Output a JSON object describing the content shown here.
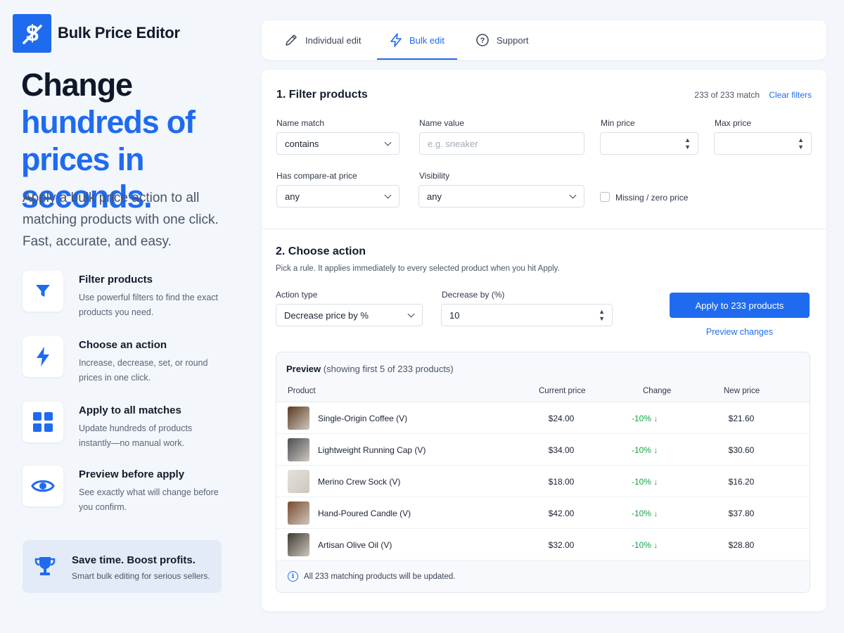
{
  "brand": {
    "name": "Bulk Price Editor"
  },
  "hero": {
    "line1": "Change",
    "line2": "hundreds of",
    "line3": "prices in seconds.",
    "subtitle": "Apply a bulk price action to all matching products with one click. Fast, accurate, and easy."
  },
  "features": [
    {
      "icon": "filter-icon",
      "title": "Filter products",
      "desc": "Use powerful filters to find the exact products you need."
    },
    {
      "icon": "lightning-icon",
      "title": "Choose an action",
      "desc": "Increase, decrease, set, or round prices in one click."
    },
    {
      "icon": "grid-icon",
      "title": "Apply to all matches",
      "desc": "Update hundreds of products instantly—no manual work."
    },
    {
      "icon": "eye-icon",
      "title": "Preview before apply",
      "desc": "See exactly what will change before you confirm."
    }
  ],
  "promo": {
    "icon": "trophy-icon",
    "title": "Save time. Boost profits.",
    "desc": "Smart bulk editing for serious sellers."
  },
  "tabs": [
    {
      "icon": "pencil-icon",
      "label": "Individual edit",
      "active": false
    },
    {
      "icon": "lightning-icon",
      "label": "Bulk edit",
      "active": true
    },
    {
      "icon": "question-icon",
      "label": "Support",
      "active": false
    }
  ],
  "filter": {
    "title": "1. Filter products",
    "match_count": "233 of 233 match",
    "clear_label": "Clear filters",
    "name_match": {
      "label": "Name match",
      "value": "contains"
    },
    "name_value": {
      "label": "Name value",
      "placeholder": "e.g. sneaker",
      "value": ""
    },
    "min_price": {
      "label": "Min price",
      "value": ""
    },
    "max_price": {
      "label": "Max price",
      "value": ""
    },
    "has_compare": {
      "label": "Has compare-at price",
      "value": "any"
    },
    "visibility": {
      "label": "Visibility",
      "value": "any"
    },
    "missing_zero": {
      "label": "Missing / zero price",
      "checked": false
    }
  },
  "action": {
    "title": "2. Choose action",
    "subtitle": "Pick a rule. It applies immediately to every selected product when you hit Apply.",
    "type": {
      "label": "Action type",
      "value": "Decrease price by %"
    },
    "amount": {
      "label": "Decrease by (%)",
      "value": "10"
    },
    "apply_label": "Apply to 233 products",
    "preview_label": "Preview changes"
  },
  "preview": {
    "title": "Preview",
    "subtitle": "(showing first 5 of 233 products)",
    "columns": {
      "product": "Product",
      "current": "Current price",
      "change": "Change",
      "new": "New price"
    },
    "rows": [
      {
        "name": "Single-Origin Coffee (V)",
        "current": "$24.00",
        "change": "-10%",
        "new": "$21.60",
        "thumb": "#5a3a22"
      },
      {
        "name": "Lightweight Running Cap (V)",
        "current": "$34.00",
        "change": "-10%",
        "new": "$30.60",
        "thumb": "#4a4d52"
      },
      {
        "name": "Merino Crew Sock (V)",
        "current": "$18.00",
        "change": "-10%",
        "new": "$16.20",
        "thumb": "#e4e1dc"
      },
      {
        "name": "Hand-Poured Candle (V)",
        "current": "$42.00",
        "change": "-10%",
        "new": "$37.80",
        "thumb": "#7a4b2e"
      },
      {
        "name": "Artisan Olive Oil (V)",
        "current": "$32.00",
        "change": "-10%",
        "new": "$28.80",
        "thumb": "#3d3a33"
      }
    ],
    "footnote": "All 233 matching products will be updated."
  },
  "colors": {
    "accent": "#1f6bf0",
    "positive": "#16a34a",
    "background": "#f3f6fb"
  }
}
